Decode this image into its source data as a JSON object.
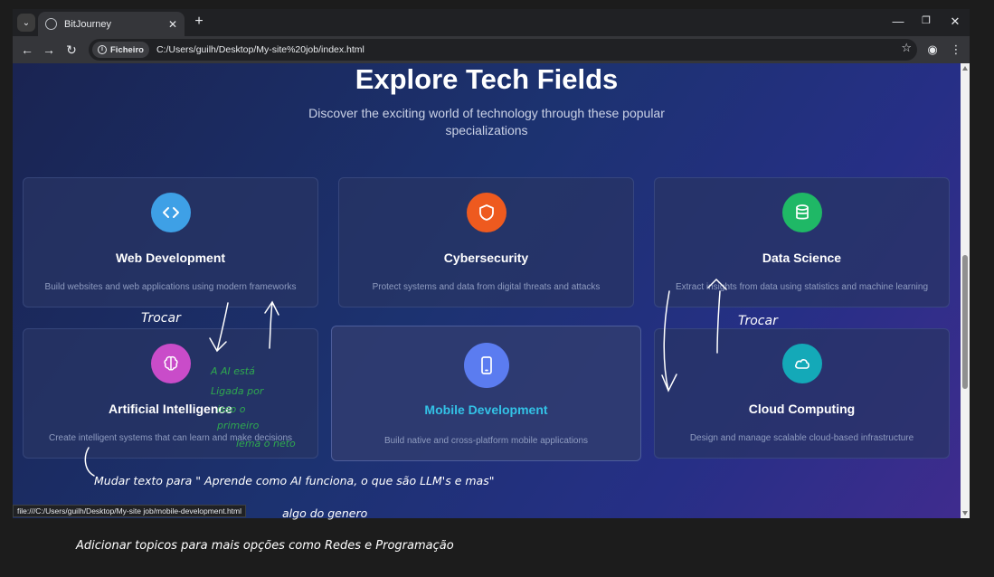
{
  "browser": {
    "tab_title": "BitJourney",
    "chip_label": "Ficheiro",
    "url": "C:/Users/guilh/Desktop/My-site%20job/index.html",
    "status_url": "file:///C:/Users/guilh/Desktop/My-site job/mobile-development.html"
  },
  "hero": {
    "title": "Explore Tech Fields",
    "subtitle": "Discover the exciting world of technology through these popular specializations"
  },
  "cards": [
    {
      "title": "Web Development",
      "desc": "Build websites and web applications using modern frameworks",
      "icon": "code-icon",
      "color": "#3ea0e6"
    },
    {
      "title": "Cybersecurity",
      "desc": "Protect systems and data from digital threats and attacks",
      "icon": "shield-icon",
      "color": "#ee5a1f"
    },
    {
      "title": "Data Science",
      "desc": "Extract insights from data using statistics and machine learning",
      "icon": "database-icon",
      "color": "#1fb866"
    },
    {
      "title": "Artificial Intelligence",
      "desc": "Create intelligent systems that can learn and make decisions",
      "icon": "brain-icon",
      "color": "#c94cc9"
    },
    {
      "title": "Mobile Development",
      "desc": "Build native and cross-platform mobile applications",
      "icon": "smartphone-icon",
      "color": "#5b7cf0"
    },
    {
      "title": "Cloud Computing",
      "desc": "Design and manage scalable cloud-based infrastructure",
      "icon": "cloud-icon",
      "color": "#14a9b8"
    }
  ],
  "annotations": {
    "trocar_left": "Trocar",
    "trocar_right": "Trocar",
    "green_note": [
      "A AI está",
      "Ligada por",
      "isso o",
      "primeiro",
      "lema o neto"
    ],
    "mudar_line1": "Mudar texto para \" Aprende como AI funciona, o que são LLM's e mas\"",
    "mudar_line2": "algo do genero",
    "adicionar": "Adicionar topicos para mais opções como Redes e Programação"
  }
}
